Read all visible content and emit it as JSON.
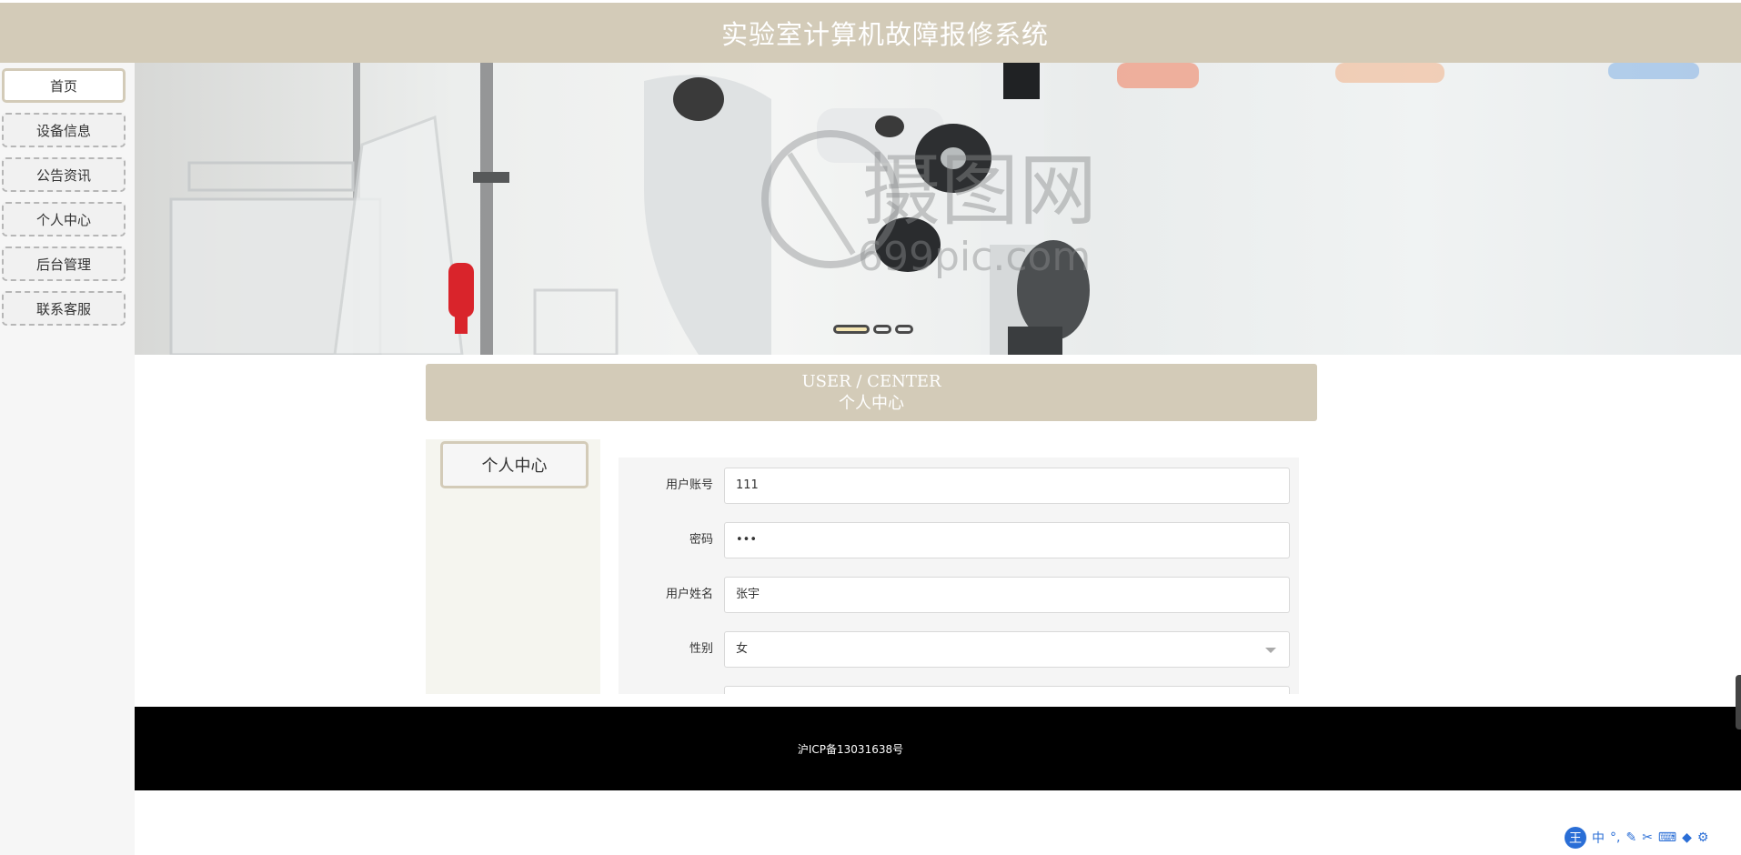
{
  "header": {
    "title": "实验室计算机故障报修系统"
  },
  "sidebar": {
    "items": [
      {
        "label": "首页",
        "active": true
      },
      {
        "label": "设备信息"
      },
      {
        "label": "公告资讯"
      },
      {
        "label": "个人中心"
      },
      {
        "label": "后台管理"
      },
      {
        "label": "联系客服"
      }
    ]
  },
  "banner": {
    "watermark_cn": "摄图网",
    "watermark_en": "699pic.com",
    "active_dot": 1,
    "dot_count": 3
  },
  "user_center": {
    "title_en": "USER / CENTER",
    "title_cn": "个人中心",
    "left_button": "个人中心"
  },
  "form": {
    "fields": [
      {
        "label": "用户账号",
        "value": "111"
      },
      {
        "label": "密码",
        "value": "•••"
      },
      {
        "label": "用户姓名",
        "value": "张宇"
      },
      {
        "label": "性别",
        "value": "女"
      }
    ]
  },
  "footer": {
    "icp": "沪ICP备13031638号"
  },
  "ime": {
    "logo": "王",
    "mode": "中"
  },
  "colors": {
    "accent": "#d3cbb8",
    "footer_bg": "#000000",
    "banner_active_dot": "#f5e6b3"
  }
}
